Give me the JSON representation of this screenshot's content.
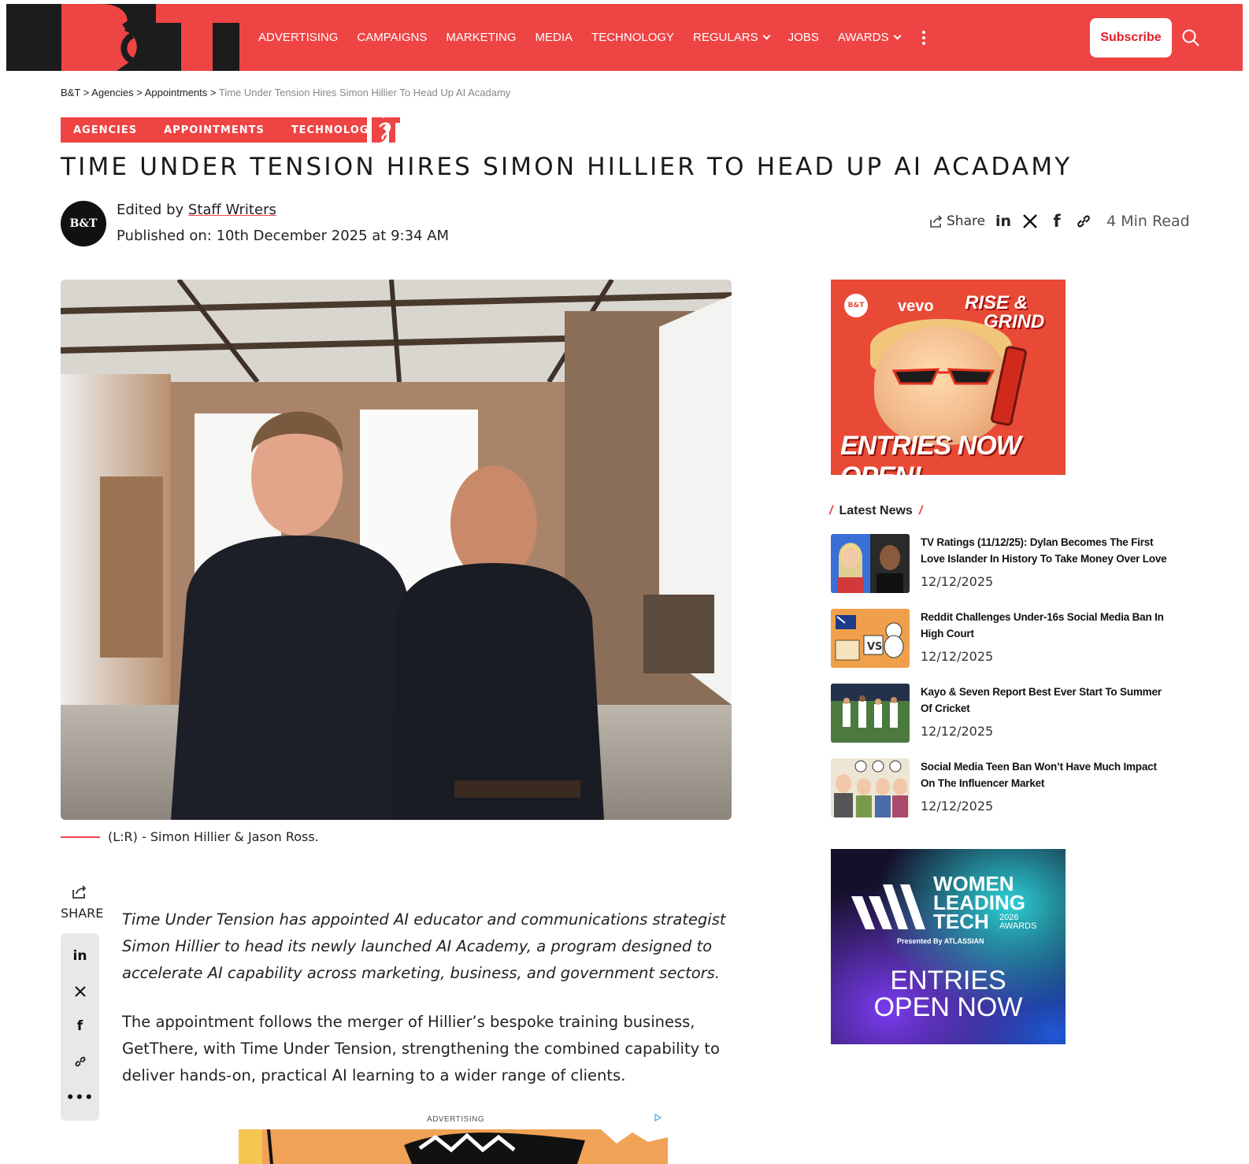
{
  "header": {
    "logo_text": "B&T",
    "nav": [
      {
        "label": "ADVERTISING",
        "dropdown": false
      },
      {
        "label": "CAMPAIGNS",
        "dropdown": false
      },
      {
        "label": "MARKETING",
        "dropdown": false
      },
      {
        "label": "MEDIA",
        "dropdown": false
      },
      {
        "label": "TECHNOLOGY",
        "dropdown": false
      },
      {
        "label": "REGULARS",
        "dropdown": true
      },
      {
        "label": "JOBS",
        "dropdown": false
      },
      {
        "label": "AWARDS",
        "dropdown": true
      }
    ],
    "subscribe_label": "Subscribe",
    "colors": {
      "brand_red": "#ef4444",
      "logo_dark": "#1c1c1c"
    }
  },
  "breadcrumb": {
    "items": [
      "B&T",
      "Agencies",
      "Appointments"
    ],
    "separator": " > ",
    "current": "Time Under Tension Hires Simon Hillier To Head Up AI Acadamy"
  },
  "categories": [
    "AGENCIES",
    "APPOINTMENTS",
    "TECHNOLOGY"
  ],
  "article": {
    "title": "TIME UNDER TENSION HIRES SIMON HILLIER TO HEAD UP AI ACADAMY",
    "byline_prefix": "Edited by",
    "author": "Staff Writers",
    "published": "Published on: 10th December 2025 at 9:34 AM",
    "avatar_text": "B&T",
    "share_label": "Share",
    "read_time": "4 Min Read",
    "caption": "(L:R) - Simon Hillier & Jason Ross.",
    "lead": "Time Under Tension has appointed AI educator and communications strategist Simon Hillier to head its newly launched AI Academy, a program designed to accelerate AI capability across marketing, business, and government sectors.",
    "paragraph": "The appointment follows the merger of Hillier’s bespoke training business, GetThere, with Time Under Tension, strengthening the combined capability to deliver hands-on, practical AI learning to a wider range of clients.",
    "ad_label": "ADVERTISING"
  },
  "rail": {
    "share_label": "SHARE",
    "icons": [
      "linkedin-icon",
      "x-icon",
      "facebook-icon",
      "link-icon",
      "more-icon"
    ]
  },
  "sidebar": {
    "ad1": {
      "vevo": "vevo",
      "rise": "RISE &",
      "grind": "GRIND",
      "entries": "ENTRIES NOW OPEN!"
    },
    "latest_news_title": "Latest News",
    "news": [
      {
        "headline": "TV Ratings (11/12/25): Dylan Becomes The First Love Islander In History To Take Money Over Love",
        "date": "12/12/2025"
      },
      {
        "headline": "Reddit Challenges Under-16s Social Media Ban In High Court",
        "date": "12/12/2025"
      },
      {
        "headline": "Kayo & Seven Report Best Ever Start To Summer Of Cricket",
        "date": "12/12/2025"
      },
      {
        "headline": "Social Media Teen Ban Won’t Have Much Impact On The Influencer Market",
        "date": "12/12/2025"
      }
    ],
    "ad2": {
      "line1": "WOMEN",
      "line2": "LEADING",
      "line3": "TECH",
      "year": "2026",
      "awards": "AWARDS",
      "presented": "Presented By  ATLASSIAN",
      "open1": "ENTRIES",
      "open2": "OPEN NOW"
    }
  }
}
